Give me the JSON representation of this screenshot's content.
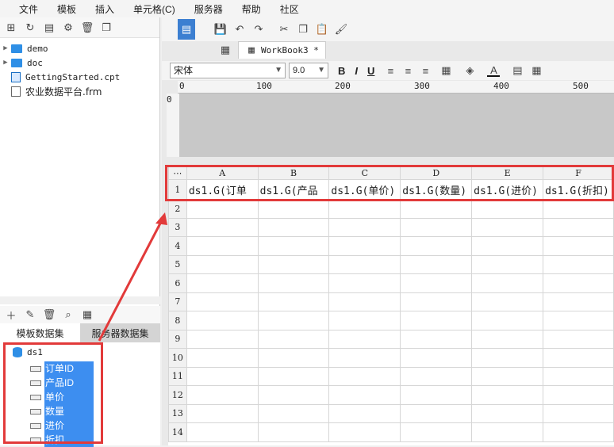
{
  "menu": [
    "文件",
    "模板",
    "插入",
    "单元格(C)",
    "服务器",
    "帮助",
    "社区"
  ],
  "file_tree": [
    {
      "name": "demo",
      "type": "folder"
    },
    {
      "name": "doc",
      "type": "folder"
    },
    {
      "name": "GettingStarted.cpt",
      "type": "cpt"
    },
    {
      "name": "农业数据平台.frm",
      "type": "frm"
    }
  ],
  "dataset_tabs": {
    "template": "模板数据集",
    "server": "服务器数据集"
  },
  "dataset": {
    "name": "ds1",
    "fields": [
      "订单ID",
      "产品ID",
      "单价",
      "数量",
      "进价",
      "折扣"
    ]
  },
  "doc_tab": "WorkBook3 *",
  "font": {
    "family": "宋体",
    "size": "9.0"
  },
  "format_buttons": {
    "bold": "B",
    "italic": "I",
    "underline": "U"
  },
  "ruler": [
    "0",
    "100",
    "200",
    "300",
    "400",
    "500"
  ],
  "vruler": "0",
  "columns": [
    "A",
    "B",
    "C",
    "D",
    "E",
    "F"
  ],
  "row1": [
    "ds1.G(订单",
    "ds1.G(产品",
    "ds1.G(单价)",
    "ds1.G(数量)",
    "ds1.G(进价)",
    "ds1.G(折扣)"
  ],
  "row_numbers": [
    "1",
    "2",
    "3",
    "4",
    "5",
    "6",
    "7",
    "8",
    "9",
    "10",
    "11",
    "12",
    "13",
    "14"
  ],
  "colors": {
    "highlight": "#3d8ef0",
    "annotation": "#e23a3a",
    "folder": "#2f8fe6"
  }
}
